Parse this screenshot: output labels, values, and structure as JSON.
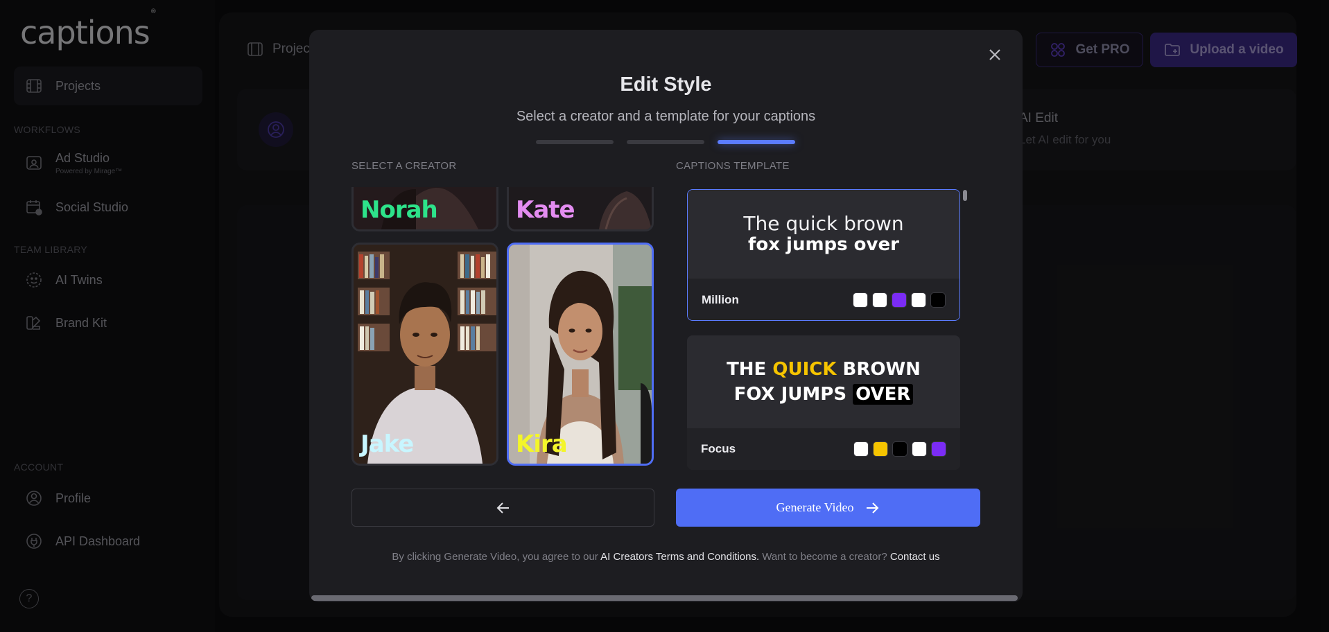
{
  "app": {
    "logo": "captions",
    "logo_mark": "®"
  },
  "sidebar": {
    "items": [
      {
        "label": "Projects",
        "icon": "film-icon",
        "active": true
      },
      {
        "label": "Ad Studio",
        "sub": "Powered by Mirage™",
        "icon": "ad-studio-icon"
      },
      {
        "label": "Social Studio",
        "icon": "calendar-check-icon"
      },
      {
        "label": "AI Twins",
        "icon": "smile-icon"
      },
      {
        "label": "Brand Kit",
        "icon": "palette-icon"
      },
      {
        "label": "Profile",
        "icon": "user-circle-icon"
      },
      {
        "label": "API Dashboard",
        "icon": "plug-icon"
      }
    ],
    "sections": {
      "workflows": "WORKFLOWS",
      "team_library": "TEAM LIBRARY",
      "account": "ACCOUNT"
    },
    "help_label": "?"
  },
  "background": {
    "header_projects": "Projects",
    "get_pro": "Get PRO",
    "upload": "Upload a video",
    "ai_edit_title": "AI Edit",
    "ai_edit_sub": "Let AI edit for you"
  },
  "modal": {
    "title": "Edit Style",
    "subtitle": "Select a creator and a template for your captions",
    "steps": 3,
    "active_step": 3,
    "creator_label": "SELECT A CREATOR",
    "template_label": "CAPTIONS TEMPLATE",
    "creators": [
      {
        "name": "Norah",
        "color": "#2de38a"
      },
      {
        "name": "Kate",
        "color": "#e38cf0"
      },
      {
        "name": "Jake",
        "color": "#c8f6ff"
      },
      {
        "name": "Kira",
        "color": "#f3f52a",
        "selected": true
      }
    ],
    "templates": [
      {
        "name": "Million",
        "line1": "The quick brown",
        "line2": "fox jumps over",
        "swatches": [
          "#ffffff",
          "#ffffff",
          "#7b2cf5",
          "#ffffff",
          "#000000"
        ],
        "selected": true
      },
      {
        "name": "Focus",
        "l1_a": "THE ",
        "l1_b": "QUICK",
        "l1_c": " BROWN",
        "l2_a": "FOX JUMPS ",
        "l2_b": "OVER",
        "swatches": [
          "#ffffff",
          "#f5c400",
          "#000000",
          "#ffffff",
          "#7b2cf5"
        ]
      }
    ],
    "generate_label": "Generate Video",
    "terms": {
      "prefix": "By clicking Generate Video, you agree to our ",
      "link": "AI Creators Terms and Conditions.",
      "middle": " Want to become a creator? ",
      "contact": "Contact us"
    }
  }
}
